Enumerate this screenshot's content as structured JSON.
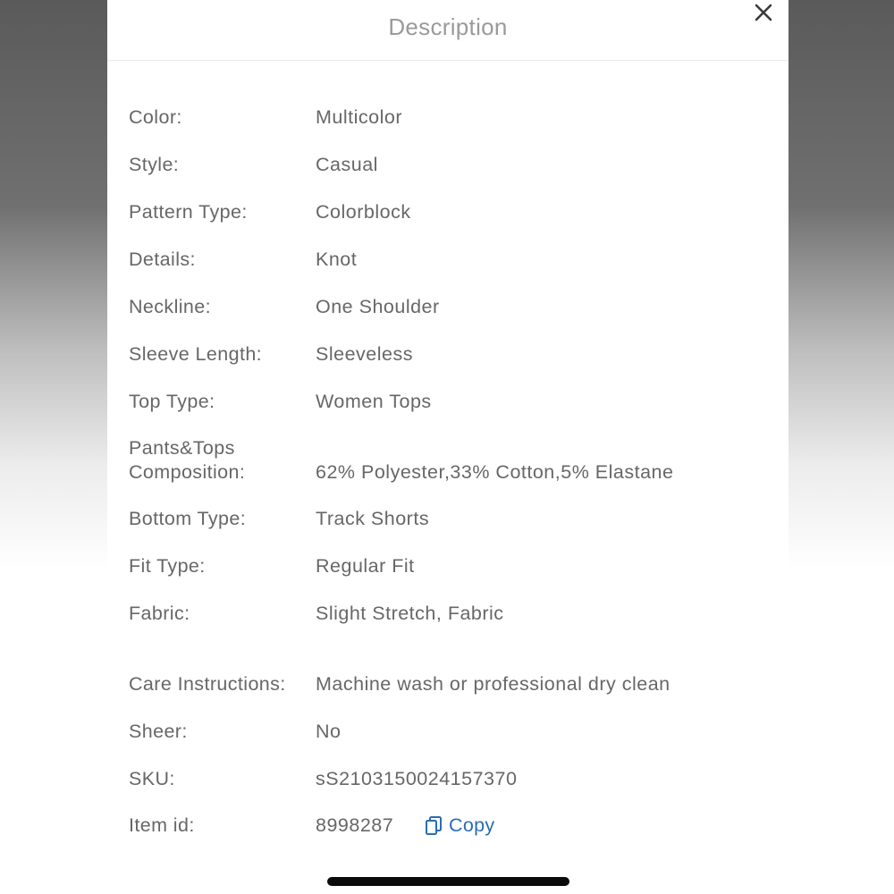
{
  "modal": {
    "title": "Description",
    "close_icon": "close-icon"
  },
  "attributes": [
    {
      "label": "Color:",
      "value": "Multicolor"
    },
    {
      "label": "Style:",
      "value": "Casual"
    },
    {
      "label": "Pattern Type:",
      "value": "Colorblock"
    },
    {
      "label": "Details:",
      "value": "Knot"
    },
    {
      "label": "Neckline:",
      "value": "One Shoulder"
    },
    {
      "label": "Sleeve Length:",
      "value": "Sleeveless"
    },
    {
      "label": "Top Type:",
      "value": "Women Tops"
    },
    {
      "label": "Pants&Tops Composition:",
      "value": "62% Polyester,33% Cotton,5% Elastane"
    },
    {
      "label": "Bottom Type:",
      "value": "Track Shorts"
    },
    {
      "label": "Fit Type:",
      "value": "Regular Fit"
    },
    {
      "label": "Fabric:",
      "value": "Slight Stretch, Fabric"
    },
    {
      "label": "Care Instructions:",
      "value": "Machine wash or professional dry clean"
    },
    {
      "label": "Sheer:",
      "value": "No"
    },
    {
      "label": "SKU:",
      "value": "sS2103150024157370"
    },
    {
      "label": "Item id:",
      "value": "8998287"
    }
  ],
  "copy": {
    "label": "Copy",
    "icon": "copy-icon"
  },
  "colors": {
    "text": "#676767",
    "title": "#9a9a9a",
    "link": "#2a6db2"
  }
}
